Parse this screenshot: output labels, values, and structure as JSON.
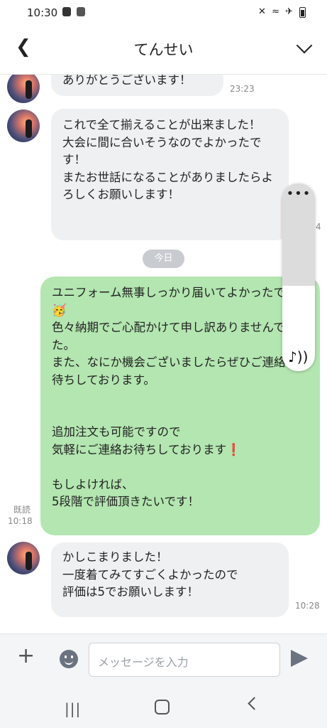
{
  "status": {
    "time": "10:30"
  },
  "header": {
    "title": "てんせい",
    "back_icon": "chevron-left-icon",
    "menu_icon": "chevron-down-icon"
  },
  "messages": [
    {
      "from": "other",
      "text": "ありがとうございます！",
      "time": "23:23"
    },
    {
      "from": "other",
      "text": "これで全て揃えることが出来ました！\n大会に間に合いそうなのでよかったです！\nまたお世話になることがありましたらよろしくお願いします！",
      "time": "4"
    },
    {
      "from": "me",
      "text": "ユニフォーム無事しっかり届いてよかったです🥳\n色々納期でご心配かけて申し訳ありませんでした。\nまた、なにか機会ございましたらぜひご連絡お待ちしております。\n\n\n追加注文も可能ですので\n気軽にご連絡お待ちしております❗️\n\nもしよければ、\n5段階で評価頂きたいです！",
      "read": "既読",
      "time": "10:18"
    },
    {
      "from": "other",
      "text": "かしこまりました！\n一度着てみてすごくよかったので\n評価は5でお願いします！",
      "time": "10:28"
    }
  ],
  "day_divider": "今日",
  "overlay": {
    "dots": "•••",
    "note": "♪))"
  },
  "composer": {
    "placeholder": "メッセージを入力",
    "plus_label": "+"
  },
  "nav": {
    "recent": "|||"
  }
}
